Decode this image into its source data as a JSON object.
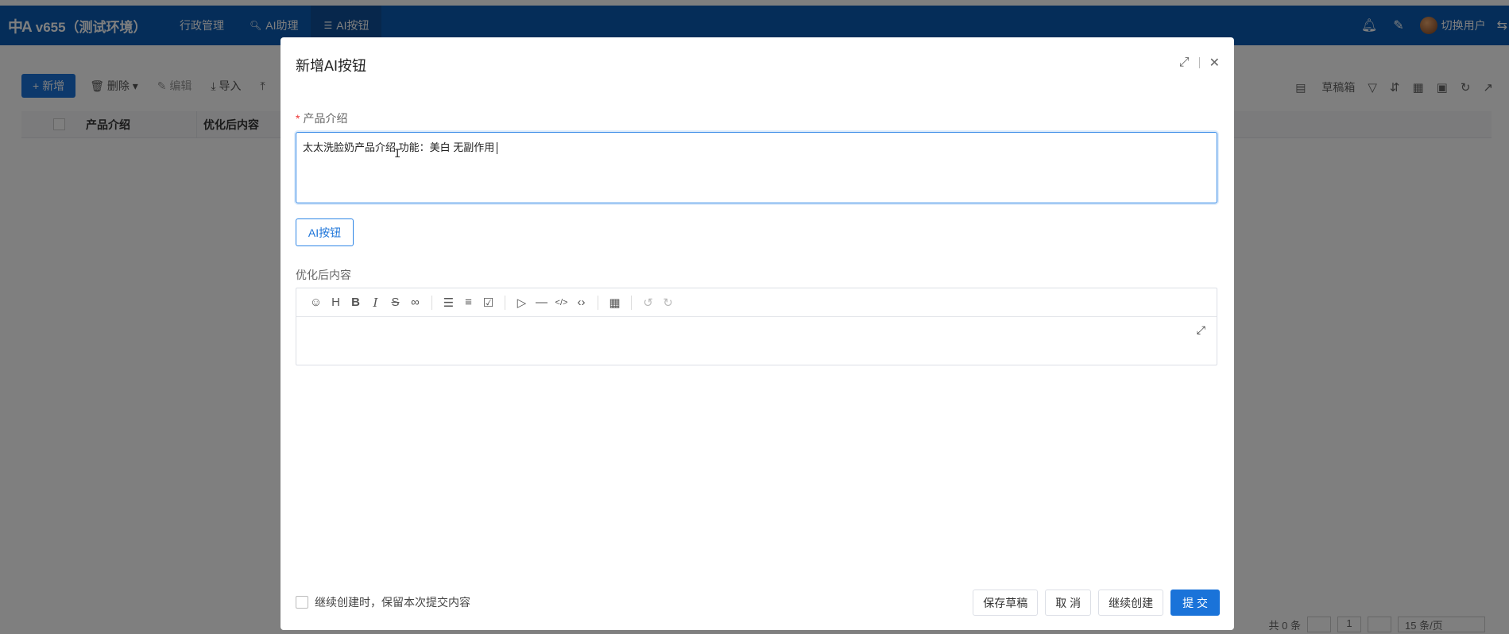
{
  "app": {
    "logo_glyph": "中A",
    "title": "v655（测试环境）",
    "nav": [
      {
        "label": "行政管理",
        "icon": "",
        "active": false
      },
      {
        "label": "AI助理",
        "icon": "search-icon",
        "active": false
      },
      {
        "label": "AI按钮",
        "icon": "document-icon",
        "active": true
      }
    ],
    "user_label": "切换用户"
  },
  "toolbar": {
    "new_label": "新增",
    "delete_label": "删除",
    "edit_label": "编辑",
    "import_label": "导入",
    "draft_label": "草稿箱"
  },
  "table": {
    "columns": [
      "产品介绍",
      "优化后内容"
    ]
  },
  "footer": {
    "total_text": "共 0 条",
    "page_number": "1",
    "page_size_text": "15 条/页"
  },
  "modal": {
    "title": "新增AI按钮",
    "field1_label": "产品介绍",
    "field1_value": "太太洗脸奶产品介绍 功能：美白 无副作用",
    "ai_button_label": "AI按钮",
    "field2_label": "优化后内容",
    "keep_label": "继续创建时，保留本次提交内容",
    "buttons": {
      "save_draft": "保存草稿",
      "cancel": "取 消",
      "continue": "继续创建",
      "submit": "提 交"
    }
  },
  "colors": {
    "navbar": "#0a5bb3",
    "primary": "#1a73d9",
    "required": "#e33333"
  }
}
